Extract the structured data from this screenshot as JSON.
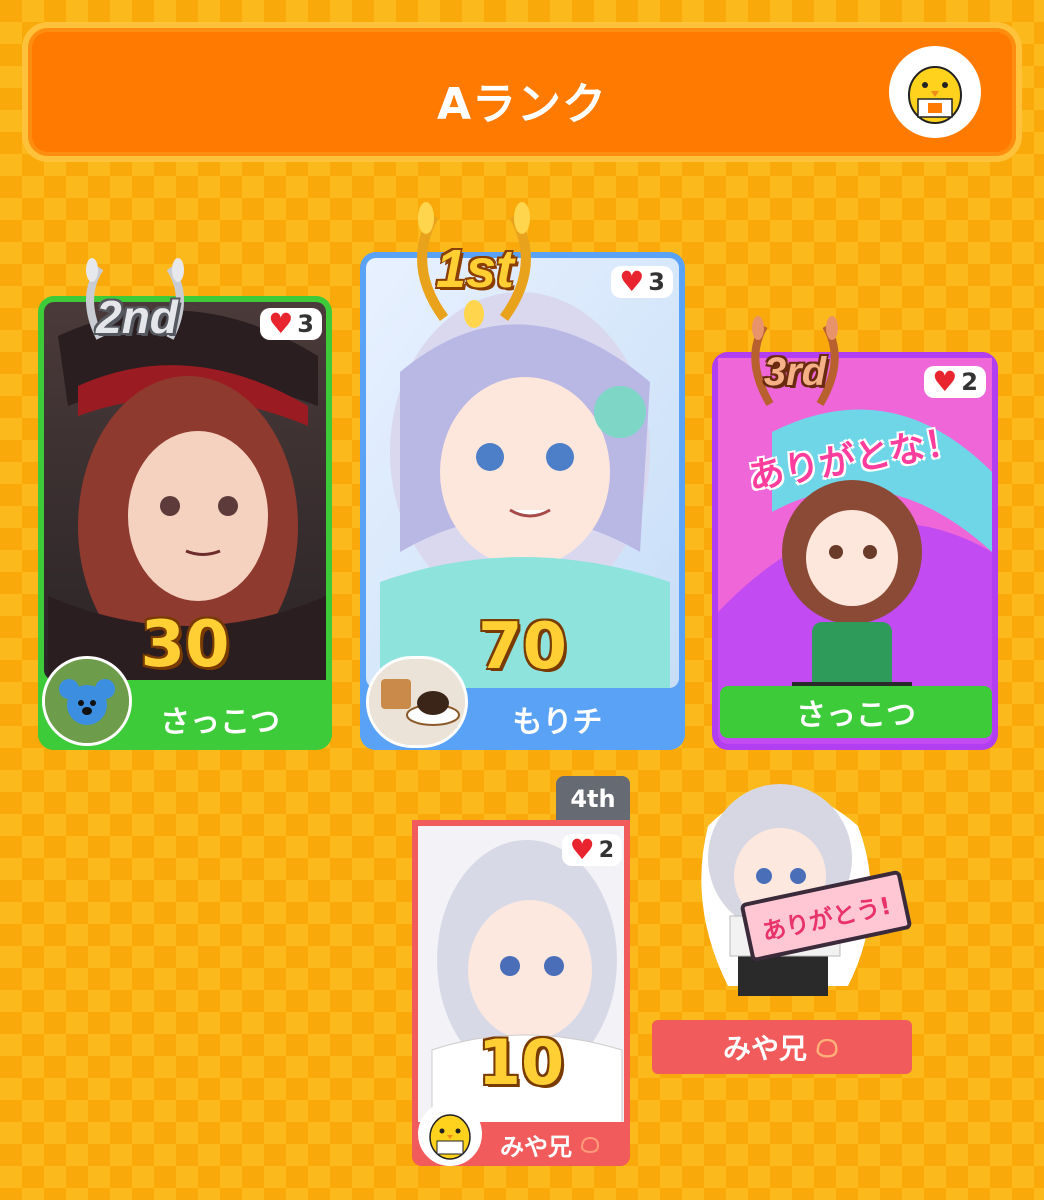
{
  "header": {
    "title": "Aランク"
  },
  "cards": [
    {
      "rank_label": "2nd",
      "hearts": "3",
      "score": "30",
      "name": "さっこつ",
      "color": "#3ecb3a"
    },
    {
      "rank_label": "1st",
      "hearts": "3",
      "score": "70",
      "name": "もりチ",
      "color": "#5aa2f5"
    },
    {
      "rank_label": "3rd",
      "hearts": "2",
      "score": "",
      "name": "さっこつ",
      "color": "#b13ef0",
      "art_text": "ありがとな！"
    },
    {
      "rank_label": "4th",
      "hearts": "2",
      "score": "10",
      "name": "みや兄",
      "color": "#f25b5b"
    }
  ],
  "chibi": {
    "sign_text": "ありがとう!",
    "name": "みや兄"
  },
  "colors": {
    "background": "#f9a90a",
    "header": "#ff7a00",
    "heart": "#e8242e",
    "gold": "#ffcf33"
  }
}
